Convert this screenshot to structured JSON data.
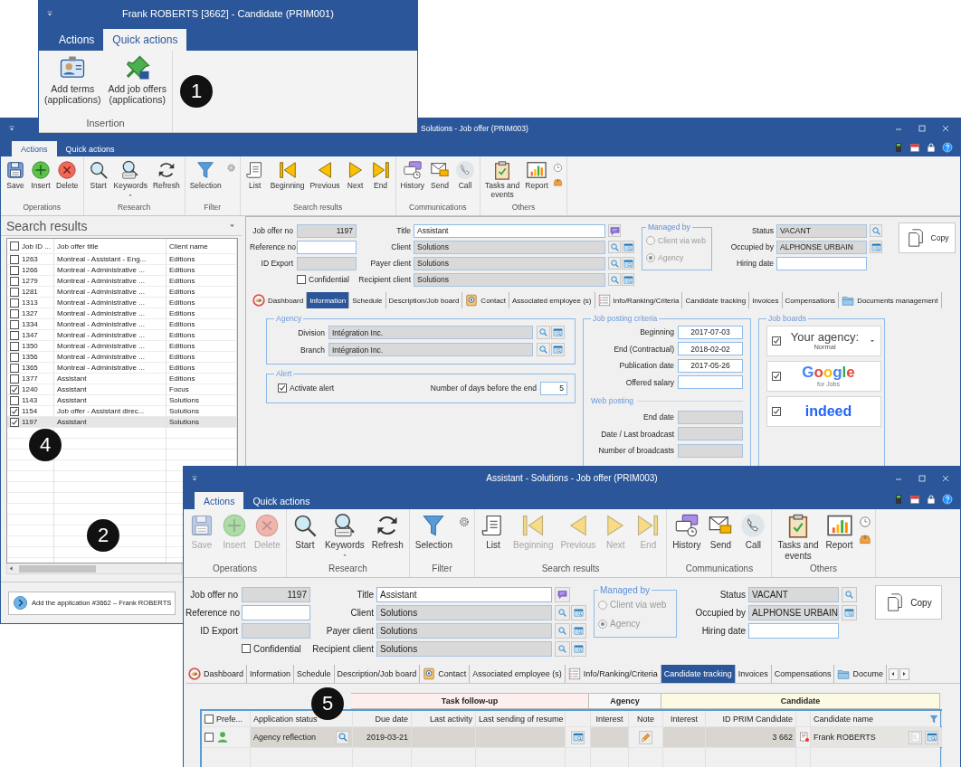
{
  "candidate_window": {
    "title": "Frank ROBERTS [3662] - Candidate (PRIM001)",
    "tabs": [
      {
        "label": "Actions",
        "selected": false
      },
      {
        "label": "Quick actions",
        "selected": true
      }
    ],
    "ribbon": [
      {
        "label": "Insertion",
        "buttons": [
          {
            "label": "Add terms\n(applications)",
            "kind": "badge",
            "disabled": false
          },
          {
            "label": "Add job offers\n(applications)",
            "kind": "pin",
            "disabled": false
          }
        ]
      }
    ]
  },
  "offer_window": {
    "title": "Solutions - Job offer (PRIM003)",
    "tabs": [
      {
        "label": "Actions",
        "selected": true
      },
      {
        "label": "Quick actions",
        "selected": false
      }
    ],
    "ribbon": [
      {
        "label": "Operations",
        "buttons": [
          {
            "label": "Save",
            "kind": "save",
            "disabled": false
          },
          {
            "label": "Insert",
            "kind": "insert",
            "disabled": false
          },
          {
            "label": "Delete",
            "kind": "delete",
            "disabled": false
          }
        ]
      },
      {
        "label": "Research",
        "buttons": [
          {
            "label": "Start",
            "kind": "search",
            "disabled": false
          },
          {
            "label": "Keywords",
            "kind": "keywords",
            "disabled": false
          },
          {
            "label": "Refresh",
            "kind": "refresh",
            "disabled": false
          }
        ]
      },
      {
        "label": "Filter",
        "buttons": [
          {
            "label": "Selection",
            "kind": "filter",
            "disabled": false
          }
        ],
        "extras": [
          {
            "kind": "gear"
          }
        ]
      },
      {
        "label": "Search results",
        "buttons": [
          {
            "label": "List",
            "kind": "list",
            "disabled": false
          },
          {
            "label": "Beginning",
            "kind": "first",
            "disabled": false
          },
          {
            "label": "Previous",
            "kind": "prev",
            "disabled": false
          },
          {
            "label": "Next",
            "kind": "next",
            "disabled": false
          },
          {
            "label": "End",
            "kind": "last",
            "disabled": false
          }
        ]
      },
      {
        "label": "Communications",
        "buttons": [
          {
            "label": "History",
            "kind": "history",
            "disabled": false
          },
          {
            "label": "Send",
            "kind": "send",
            "disabled": false
          },
          {
            "label": "Call",
            "kind": "call",
            "disabled": false
          }
        ]
      },
      {
        "label": "Others",
        "buttons": [
          {
            "label": "Tasks and\nevents",
            "kind": "tasks",
            "disabled": false
          },
          {
            "label": "Report",
            "kind": "report",
            "disabled": false
          }
        ],
        "extras": [
          {
            "kind": "clock"
          },
          {
            "kind": "inbox"
          }
        ]
      }
    ],
    "search_panel": {
      "title": "Search results",
      "columns": [
        "Job ID ...",
        "Job offer title",
        "Client name"
      ],
      "header_checked": false,
      "rows": [
        {
          "id": "1263",
          "title": "Montreal - Assistant - Eng...",
          "client": "Editions",
          "checked": false,
          "selected": false
        },
        {
          "id": "1266",
          "title": "Montreal - Administrative ...",
          "client": "Editions",
          "checked": false,
          "selected": false
        },
        {
          "id": "1279",
          "title": "Montreal - Administrative ...",
          "client": "Editions",
          "checked": false,
          "selected": false
        },
        {
          "id": "1281",
          "title": "Montreal - Administrative ...",
          "client": "Editions",
          "checked": false,
          "selected": false
        },
        {
          "id": "1313",
          "title": "Montreal - Administrative ...",
          "client": "Editions",
          "checked": false,
          "selected": false
        },
        {
          "id": "1327",
          "title": "Montreal - Administrative ...",
          "client": "Editions",
          "checked": false,
          "selected": false
        },
        {
          "id": "1334",
          "title": "Montreal - Administrative ...",
          "client": "Editions",
          "checked": false,
          "selected": false
        },
        {
          "id": "1347",
          "title": "Montreal - Administrative ...",
          "client": "Editions",
          "checked": false,
          "selected": false
        },
        {
          "id": "1350",
          "title": "Montreal - Administrative ...",
          "client": "Editions",
          "checked": false,
          "selected": false
        },
        {
          "id": "1356",
          "title": "Montreal - Administrative ...",
          "client": "Editions",
          "checked": false,
          "selected": false
        },
        {
          "id": "1365",
          "title": "Montreal - Administrative ...",
          "client": "Editions",
          "checked": false,
          "selected": false
        },
        {
          "id": "1377",
          "title": "Assistant",
          "client": "Editions",
          "checked": false,
          "selected": false
        },
        {
          "id": "1240",
          "title": "Assistant",
          "client": "Focus",
          "checked": true,
          "selected": false
        },
        {
          "id": "1143",
          "title": "Assistant",
          "client": "Solutions",
          "checked": false,
          "selected": false
        },
        {
          "id": "1154",
          "title": "Job offer - Assistant direc...",
          "client": "Solutions",
          "checked": true,
          "selected": false
        },
        {
          "id": "1197",
          "title": "Assistant",
          "client": "Solutions",
          "checked": true,
          "selected": true
        }
      ],
      "action": "Add the application #3662 – Frank ROBERTS"
    },
    "form": {
      "left_fields": [
        {
          "label": "Job offer no",
          "value": "1197",
          "readonly": true
        },
        {
          "label": "Reference no",
          "readonly": false
        },
        {
          "label": "ID Export",
          "readonly": true
        }
      ],
      "confidential": {
        "label": "Confidential",
        "checked": false
      },
      "mid_fields": [
        {
          "label": "Title",
          "value": "Assistant",
          "readonly": false,
          "kind": "note"
        },
        {
          "label": "Client",
          "value": "Solutions",
          "readonly": true,
          "kind": "lookup"
        },
        {
          "label": "Payer client",
          "value": "Solutions",
          "readonly": true,
          "kind": "lookup"
        },
        {
          "label": "Recipient client",
          "value": "Solutions",
          "readonly": true,
          "kind": "lookup"
        }
      ],
      "managed_by": {
        "label": "Managed by",
        "disabled": true,
        "options": [
          {
            "label": "Client via web",
            "selected": false
          },
          {
            "label": "Agency",
            "selected": true
          }
        ]
      },
      "right_fields": [
        {
          "label": "Status",
          "value": "VACANT",
          "readonly": true,
          "kind": "search"
        },
        {
          "label": "Occupied by",
          "value": "ALPHONSE URBAIN",
          "readonly": true,
          "kind": "browse"
        },
        {
          "label": "Hiring date",
          "readonly": false,
          "kind": "none"
        }
      ],
      "copy": "Copy"
    },
    "detail_tabs": [
      {
        "label": "Dashboard",
        "kind": "dashboard",
        "selected": false
      },
      {
        "label": "Information",
        "kind": "plain",
        "selected": true
      },
      {
        "label": "Schedule",
        "kind": "plain",
        "selected": false
      },
      {
        "label": "Description/Job board",
        "kind": "plain",
        "selected": false
      },
      {
        "label": "Contact",
        "kind": "contact",
        "selected": false
      },
      {
        "label": "Associated employee (s)",
        "kind": "plain",
        "selected": false
      },
      {
        "label": "Info/Ranking/Criteria",
        "kind": "list",
        "selected": false
      },
      {
        "label": "Candidate tracking",
        "kind": "plain",
        "selected": false
      },
      {
        "label": "Invoices",
        "kind": "plain",
        "selected": false
      },
      {
        "label": "Compensations",
        "kind": "plain",
        "selected": false
      },
      {
        "label": "Documents management",
        "kind": "folder",
        "selected": false
      }
    ],
    "info": {
      "agency": {
        "title": "Agency",
        "fields": [
          {
            "label": "Division",
            "value": "Intégration Inc.",
            "readonly": true
          },
          {
            "label": "Branch",
            "value": "Intégration Inc.",
            "readonly": true
          }
        ]
      },
      "alert": {
        "title": "Alert",
        "activate": {
          "label": "Activate alert",
          "checked": true
        },
        "days_label": "Number of days before the end",
        "days": "5"
      },
      "criteria": {
        "title": "Job posting criteria",
        "fields": [
          {
            "label": "Beginning",
            "value": "2017-07-03",
            "readonly": false
          },
          {
            "label": "End (Contractual)",
            "value": "2018-02-02",
            "readonly": false
          },
          {
            "label": "Publication date",
            "value": "2017-05-26",
            "readonly": false
          },
          {
            "label": "Offered salary",
            "readonly": false
          }
        ],
        "web_title": "Web posting",
        "web_fields": [
          {
            "label": "End date",
            "readonly": true
          },
          {
            "label": "Date / Last broadcast",
            "readonly": true
          },
          {
            "label": "Number of broadcasts",
            "readonly": true
          }
        ]
      },
      "job_boards": {
        "title": "Job boards",
        "boards": [
          {
            "kind": "agency",
            "checked": true,
            "label": "Your agency:",
            "sub": "Normal"
          },
          {
            "kind": "google",
            "checked": true,
            "label": "Google",
            "sub": "for Jobs"
          },
          {
            "kind": "indeed",
            "checked": true,
            "label": "indeed"
          }
        ]
      }
    }
  },
  "tracking_window": {
    "title": "Assistant - Solutions - Job offer (PRIM003)",
    "tabs": [
      {
        "label": "Actions",
        "selected": true
      },
      {
        "label": "Quick actions",
        "selected": false
      }
    ],
    "ribbon": [
      {
        "label": "Operations",
        "buttons": [
          {
            "label": "Save",
            "kind": "save",
            "disabled": true
          },
          {
            "label": "Insert",
            "kind": "insert",
            "disabled": true
          },
          {
            "label": "Delete",
            "kind": "delete",
            "disabled": true
          }
        ]
      },
      {
        "label": "Research",
        "buttons": [
          {
            "label": "Start",
            "kind": "search",
            "disabled": false
          },
          {
            "label": "Keywords",
            "kind": "keywords",
            "disabled": false
          },
          {
            "label": "Refresh",
            "kind": "refresh",
            "disabled": false
          }
        ]
      },
      {
        "label": "Filter",
        "buttons": [
          {
            "label": "Selection",
            "kind": "filter",
            "disabled": false
          }
        ],
        "extras": [
          {
            "kind": "gear"
          }
        ]
      },
      {
        "label": "Search results",
        "buttons": [
          {
            "label": "List",
            "kind": "list",
            "disabled": false
          },
          {
            "label": "Beginning",
            "kind": "first",
            "disabled": true
          },
          {
            "label": "Previous",
            "kind": "prev",
            "disabled": true
          },
          {
            "label": "Next",
            "kind": "next",
            "disabled": true
          },
          {
            "label": "End",
            "kind": "last",
            "disabled": true
          }
        ]
      },
      {
        "label": "Communications",
        "buttons": [
          {
            "label": "History",
            "kind": "history",
            "disabled": false
          },
          {
            "label": "Send",
            "kind": "send",
            "disabled": false
          },
          {
            "label": "Call",
            "kind": "call",
            "disabled": false
          }
        ]
      },
      {
        "label": "Others",
        "buttons": [
          {
            "label": "Tasks and\nevents",
            "kind": "tasks",
            "disabled": false
          },
          {
            "label": "Report",
            "kind": "report",
            "disabled": false
          }
        ],
        "extras": [
          {
            "kind": "clock"
          },
          {
            "kind": "inbox"
          }
        ]
      }
    ],
    "form": {
      "left_fields": [
        {
          "label": "Job offer no",
          "value": "1197",
          "readonly": true
        },
        {
          "label": "Reference no",
          "readonly": false
        },
        {
          "label": "ID Export",
          "readonly": true
        }
      ],
      "confidential": {
        "label": "Confidential",
        "checked": false
      },
      "mid_fields": [
        {
          "label": "Title",
          "value": "Assistant",
          "readonly": false,
          "kind": "note"
        },
        {
          "label": "Client",
          "value": "Solutions",
          "readonly": true,
          "kind": "lookup"
        },
        {
          "label": "Payer client",
          "value": "Solutions",
          "readonly": true,
          "kind": "lookup"
        },
        {
          "label": "Recipient client",
          "value": "Solutions",
          "readonly": true,
          "kind": "lookup"
        }
      ],
      "managed_by": {
        "label": "Managed by",
        "disabled": true,
        "options": [
          {
            "label": "Client via web",
            "selected": false
          },
          {
            "label": "Agency",
            "selected": true
          }
        ]
      },
      "right_fields": [
        {
          "label": "Status",
          "value": "VACANT",
          "readonly": true,
          "kind": "search"
        },
        {
          "label": "Occupied by",
          "value": "ALPHONSE URBAIN",
          "readonly": true,
          "kind": "browse"
        },
        {
          "label": "Hiring date",
          "readonly": false,
          "kind": "none"
        }
      ],
      "copy": "Copy"
    },
    "detail_tabs": [
      {
        "label": "Dashboard",
        "kind": "dashboard",
        "selected": false
      },
      {
        "label": "Information",
        "kind": "plain",
        "selected": false
      },
      {
        "label": "Schedule",
        "kind": "plain",
        "selected": false
      },
      {
        "label": "Description/Job board",
        "kind": "plain",
        "selected": false
      },
      {
        "label": "Contact",
        "kind": "contact",
        "selected": false
      },
      {
        "label": "Associated employee (s)",
        "kind": "plain",
        "selected": false
      },
      {
        "label": "Info/Ranking/Criteria",
        "kind": "list",
        "selected": false
      },
      {
        "label": "Candidate tracking",
        "kind": "plain",
        "selected": true
      },
      {
        "label": "Invoices",
        "kind": "plain",
        "selected": false
      },
      {
        "label": "Compensations",
        "kind": "plain",
        "selected": false
      },
      {
        "label": "Docume",
        "kind": "folder",
        "selected": false
      }
    ],
    "grid": {
      "groups": [
        {
          "label": "Task follow-up",
          "color": "#fcefed"
        },
        {
          "label": "Agency",
          "color": "#f7f7f7"
        },
        {
          "label": "Candidate",
          "color": "#fcfae2"
        }
      ],
      "columns": [
        "Prefe...",
        "Application status",
        "Due date",
        "Last activity",
        "Last sending of resume",
        "Interest",
        "Note",
        "Interest",
        "ID PRIM Candidate",
        "Candidate name"
      ],
      "header_checked": false,
      "rows": [
        {
          "checked": false,
          "status": "Agency reflection",
          "due_date": "2019-03-21",
          "id_prim": "3 662",
          "candidate": "Frank ROBERTS"
        }
      ]
    }
  },
  "callouts": [
    {
      "label": "1"
    },
    {
      "label": "4"
    },
    {
      "label": "2"
    },
    {
      "label": "5"
    }
  ]
}
